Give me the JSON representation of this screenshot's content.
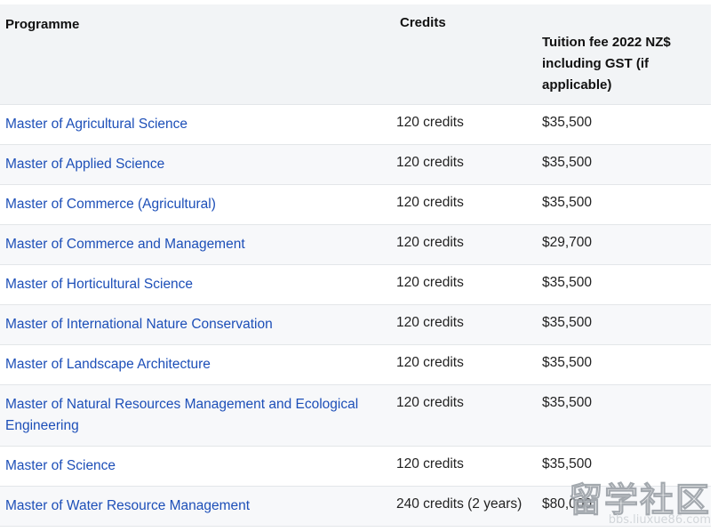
{
  "table": {
    "headers": {
      "programme": "Programme",
      "credits": "Credits",
      "fee": "Tuition fee 2022 NZ$ including GST (if applicable)"
    },
    "rows": [
      {
        "programme": "Master of Agricultural Science",
        "credits": "120 credits",
        "fee": "$35,500"
      },
      {
        "programme": "Master of Applied Science",
        "credits": "120 credits",
        "fee": "$35,500"
      },
      {
        "programme": "Master of Commerce (Agricultural)",
        "credits": "120 credits",
        "fee": "$35,500"
      },
      {
        "programme": "Master of Commerce and Management",
        "credits": "120 credits",
        "fee": "$29,700"
      },
      {
        "programme": "Master of Horticultural Science",
        "credits": "120 credits",
        "fee": "$35,500"
      },
      {
        "programme": "Master of International Nature Conservation",
        "credits": "120 credits",
        "fee": "$35,500"
      },
      {
        "programme": "Master of Landscape Architecture",
        "credits": "120 credits",
        "fee": "$35,500"
      },
      {
        "programme": "Master of Natural Resources Management and Ecological Engineering",
        "credits": "120 credits",
        "fee": "$35,500"
      },
      {
        "programme": "Master of Science",
        "credits": "120 credits",
        "fee": "$35,500"
      },
      {
        "programme": "Master of Water Resource Management",
        "credits": "240 credits (2 years)",
        "fee": "$80,000"
      }
    ]
  },
  "watermark": {
    "text": "留学社区",
    "url": "bbs.liuxue86.com"
  }
}
